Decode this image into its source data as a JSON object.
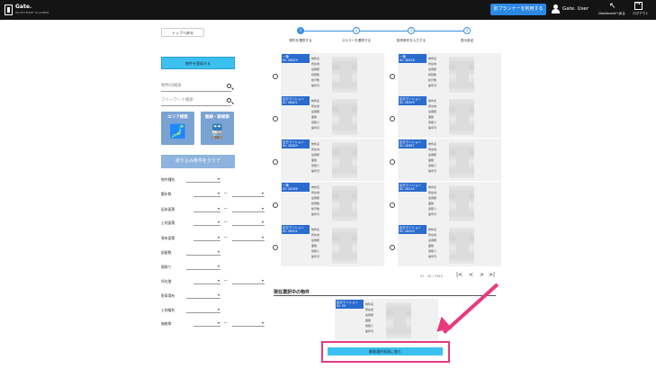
{
  "header": {
    "logo_name": "Gate.",
    "logo_sub": "INVESTMENT PLANNER",
    "planner_button": "別プランナーを利用する",
    "user_name": "Gate. User",
    "dashboard_label": "Dashboardへ戻る",
    "dashboard_icon": "↖",
    "logout_label": "ログアウト"
  },
  "sidebar": {
    "back_button": "トップへ戻る",
    "register_button": "物件を登録する",
    "id_search_placeholder": "物件ID検索",
    "free_search_placeholder": "フリーワード検索",
    "area_search": "エリア検索",
    "area_icon": "🗾",
    "station_search": "路線・駅検索",
    "station_icon": "🚆",
    "clear_button": "絞り込み条件をクリア",
    "filters": [
      {
        "label": "物件種別",
        "range": false
      },
      {
        "label": "築年数",
        "range": true,
        "tilde": "〜"
      },
      {
        "label": "延床面積",
        "range": true,
        "tilde": "〜"
      },
      {
        "label": "土地面積",
        "range": true,
        "tilde": "〜"
      },
      {
        "label": "専有面積",
        "range": true,
        "tilde": "〜"
      },
      {
        "label": "部屋数",
        "range": false
      },
      {
        "label": "間取り",
        "range": false
      },
      {
        "label": "所在階",
        "range": true,
        "tilde": "〜"
      },
      {
        "label": "駐車場有",
        "range": false
      },
      {
        "label": "土地権利",
        "range": false
      },
      {
        "label": "価格帯",
        "range": true,
        "tilde": "〜"
      }
    ]
  },
  "steps": [
    {
      "num": "1",
      "label": "物件を選択する"
    },
    {
      "num": "2",
      "label": "スカラーを選択する"
    },
    {
      "num": "3",
      "label": "投資条件を入力する"
    },
    {
      "num": "4",
      "label": "表示設定"
    }
  ],
  "cards": [
    {
      "tag1": "一棟",
      "tag2": "ID: 28429",
      "fields": [
        "物件名",
        "所在地",
        "最寄駅",
        "総階数",
        "総戸数",
        "築年月"
      ]
    },
    {
      "tag1": "一棟",
      "tag2": "ID: 28428",
      "fields": [
        "物件名",
        "所在地",
        "最寄駅",
        "総階数",
        "総戸数",
        "築年月"
      ]
    },
    {
      "tag1": "区分マンション",
      "tag2": "ID: 28402",
      "fields": [
        "物件名",
        "所在地",
        "最寄駅",
        "面積",
        "間取り",
        "築年月"
      ]
    },
    {
      "tag1": "区分マンション",
      "tag2": "ID: 28399",
      "fields": [
        "物件名",
        "所在地",
        "最寄駅",
        "面積",
        "間取り",
        "築年月"
      ]
    },
    {
      "tag1": "区分マンション",
      "tag2": "ID: 28389",
      "fields": [
        "物件名",
        "所在地",
        "最寄駅",
        "面積",
        "間取り",
        "築年月"
      ]
    },
    {
      "tag1": "区分マンション",
      "tag2": "ID: 28387",
      "fields": [
        "物件名",
        "所在地",
        "最寄駅",
        "面積",
        "間取り",
        "築年月"
      ]
    },
    {
      "tag1": "一棟",
      "tag2": "ID: 28166",
      "fields": [
        "物件名",
        "所在地",
        "最寄駅",
        "総階数",
        "総戸数",
        "築年月"
      ]
    },
    {
      "tag1": "区分マンション",
      "tag2": "ID: 28249",
      "fields": [
        "物件名",
        "所在地",
        "最寄駅",
        "面積",
        "間取り",
        "築年月"
      ]
    },
    {
      "tag1": "区分マンション",
      "tag2": "ID: 28204",
      "fields": [
        "物件名",
        "所在地",
        "最寄駅",
        "面積",
        "間取り",
        "築年月"
      ]
    },
    {
      "tag1": "区分マンション",
      "tag2": "ID: 28200",
      "fields": [
        "物件名",
        "所在地",
        "最寄駅",
        "面積",
        "間取り",
        "築年月"
      ]
    }
  ],
  "pagination": {
    "count": "01 - 40 / 2944",
    "first": "|<",
    "prev": "<",
    "next": ">",
    "last": ">|"
  },
  "selected": {
    "title": "現在選択中の物件",
    "card": {
      "tag1": "区分マンション",
      "tag2": "ID: 59",
      "fields": [
        "物件名",
        "所在地",
        "最寄駅",
        "面積",
        "間取り",
        "築年月"
      ]
    }
  },
  "submit_button": "顧客選択画面に進む",
  "colors": {
    "accent": "#3cc0ef",
    "tag": "#2a6bcf",
    "highlight": "#e8397d"
  }
}
